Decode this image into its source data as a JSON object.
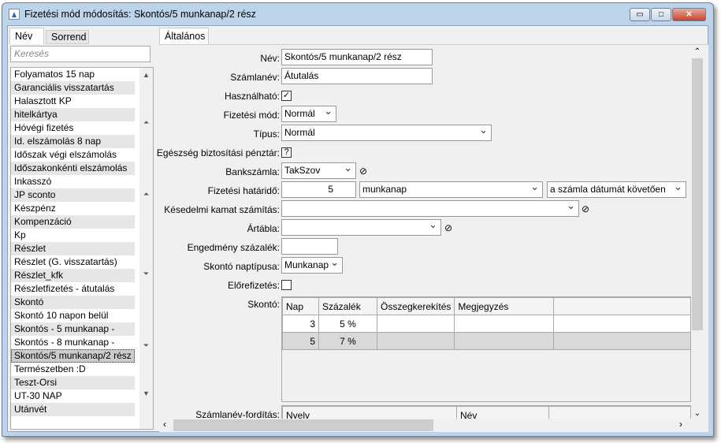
{
  "window": {
    "title": "Fizetési mód módosítás: Skontós/5 munkanap/2 rész",
    "minimize": "▭",
    "maximize": "□",
    "close": "✕"
  },
  "left": {
    "tabs": [
      "Név",
      "Sorrend"
    ],
    "search_placeholder": "Keresés",
    "items": [
      "Folyamatos 15 nap",
      "Garanciális visszatartás",
      "Halasztott KP",
      "hitelkártya",
      "Hóvégi fizetés",
      "Id. elszámolás 8 nap",
      "Időszak végi elszámolás",
      "Időszakonkénti elszámolás",
      "Inkasszó",
      "JP sconto",
      "Készpénz",
      "Kompenzáció",
      "Kp",
      "Részlet",
      "Részlet (G. visszatartás)",
      "Részlet_kfk",
      "Részletfizetés - átutalás",
      "Skontó",
      "Skontó 10 napon belül",
      "Skontós - 5 munkanap -",
      "Skontós - 8 munkanap -",
      "Skontós/5 munkanap/2 rész",
      "Természetben :D",
      "Teszt-Orsi",
      "UT-30 NAP",
      "Utánvét"
    ],
    "selected_index": 21
  },
  "form": {
    "tab": "Általános",
    "labels": {
      "nev": "Név:",
      "szamlanev": "Számlanév:",
      "hasznalhato": "Használható:",
      "fizmod": "Fizetési mód:",
      "tipus": "Típus:",
      "egeszseg": "Egészség biztosítási pénztár:",
      "bankszamla": "Bankszámla:",
      "hatarido": "Fizetési határidő:",
      "kesedelmi": "Késedelmi kamat számítás:",
      "artabla": "Ártábla:",
      "engedmeny": "Engedmény százalék:",
      "naptipus": "Skontó naptípusa:",
      "elorefizetes": "Előrefizetés:",
      "skonto": "Skontó:",
      "forditas": "Számlanév-fordítás:"
    },
    "values": {
      "nev": "Skontós/5 munkanap/2 rész",
      "szamlanev": "Átutalás",
      "hasznalhato": "✓",
      "fizmod": "Normál",
      "tipus": "Normál",
      "egeszseg": "?",
      "bankszamla": "TakSzov",
      "hatarido_num": "5",
      "hatarido_unit": "munkanap",
      "hatarido_ref": "a számla dátumát követően",
      "kesedelmi": "",
      "artabla": "",
      "engedmeny": "",
      "naptipus": "Munkanap",
      "elorefizetes": ""
    },
    "skonto_table": {
      "headers": [
        "Nap",
        "Százalék",
        "Összegkerekítés",
        "Megjegyzés"
      ],
      "rows": [
        [
          "3",
          "5 %",
          "",
          ""
        ],
        [
          "5",
          "7 %",
          "",
          ""
        ]
      ]
    },
    "forditas_table": {
      "headers": [
        "Nyelv",
        "Név"
      ]
    }
  }
}
